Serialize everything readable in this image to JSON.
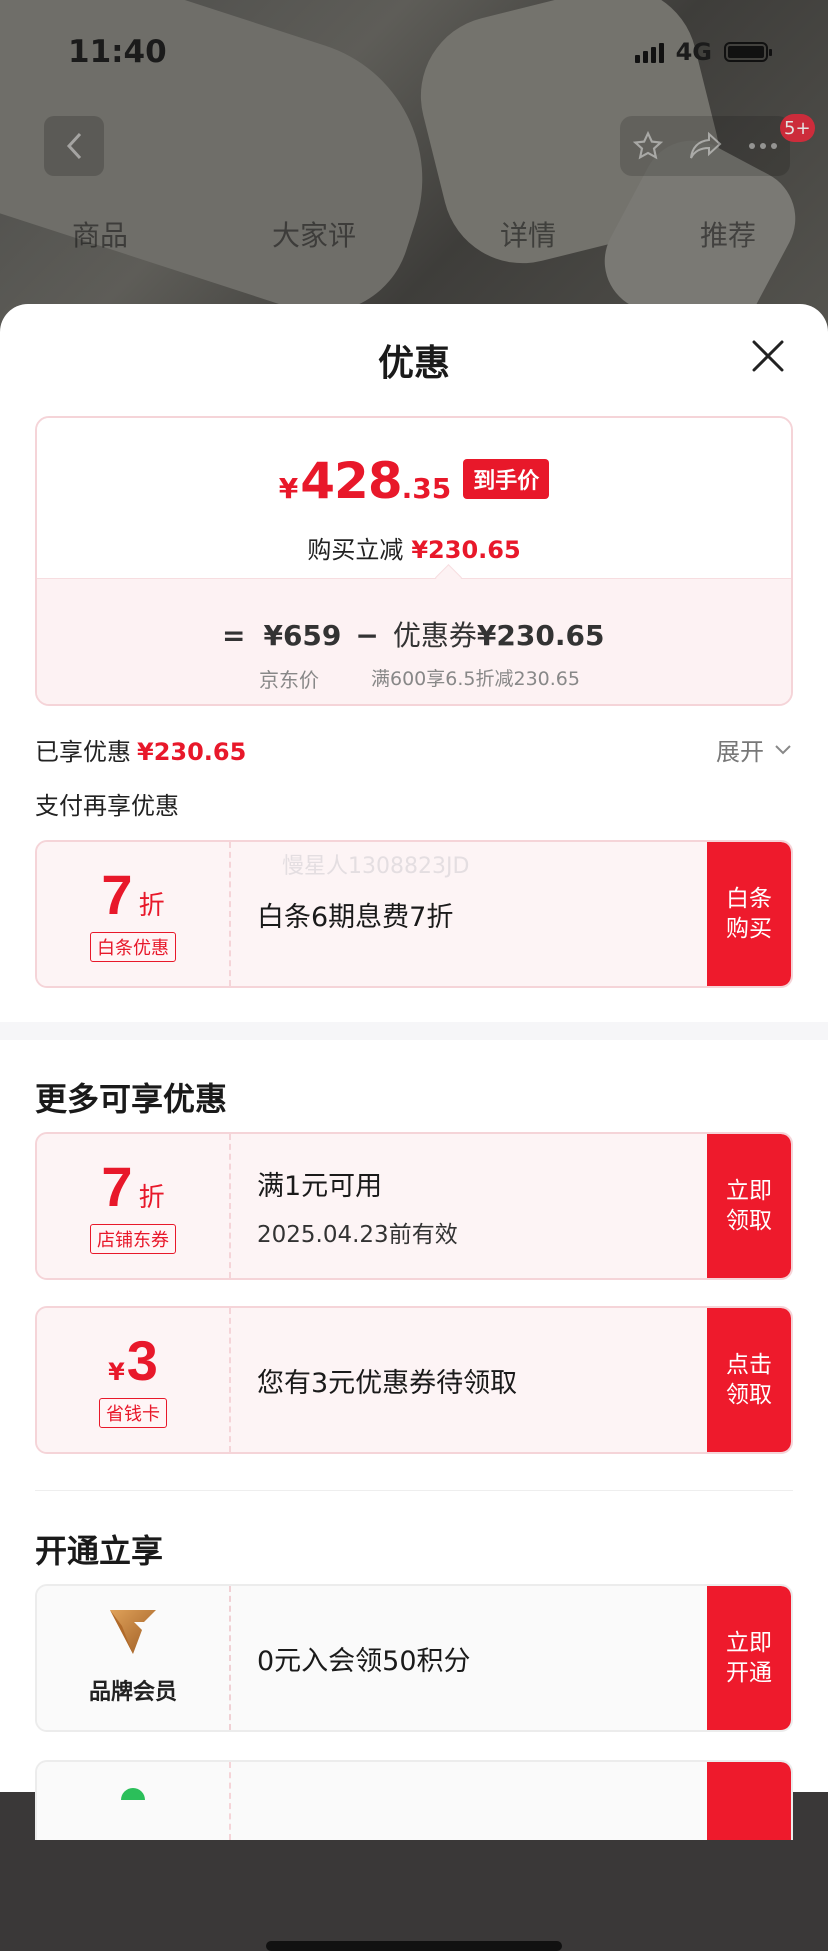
{
  "status": {
    "time": "11:40",
    "network": "4G"
  },
  "bg_page": {
    "badge": "5+",
    "tabs": [
      "商品",
      "大家评",
      "详情",
      "推荐"
    ]
  },
  "sheet": {
    "title": "优惠",
    "price_card": {
      "currency": "¥",
      "price_int": "428",
      "price_dec": ".35",
      "price_tag": "到手价",
      "reduce_label": "购买立减",
      "reduce_amount": "¥230.65",
      "eq": "=",
      "jd_price": "¥659",
      "minus": "−",
      "coupon_label": "优惠券",
      "coupon_amount": "¥230.65",
      "jd_price_label": "京东价",
      "coupon_rule": "满600享6.5折减230.65"
    },
    "enjoyed_label": "已享优惠",
    "enjoyed_amount": "¥230.65",
    "expand_label": "展开",
    "pay_more_label": "支付再享优惠",
    "watermark": "慢星人1308823JD",
    "pay_coupons": [
      {
        "value": "7",
        "unit": "折",
        "tag": "白条优惠",
        "title": "白条6期息费7折",
        "cta": "白条购买"
      }
    ],
    "more_title": "更多可享优惠",
    "more_coupons": [
      {
        "value": "7",
        "unit": "折",
        "tag": "店铺东券",
        "title": "满1元可用",
        "subtitle": "2025.04.23前有效",
        "cta": "立即领取"
      },
      {
        "currency": "¥",
        "value": "3",
        "tag": "省钱卡",
        "title": "您有3元优惠券待领取",
        "cta": "点击领取"
      }
    ],
    "open_title": "开通立享",
    "open_items": [
      {
        "label": "品牌会员",
        "title": "0元入会领50积分",
        "cta": "立即开通"
      }
    ]
  },
  "colors": {
    "accent": "#e8182a",
    "cta": "#ee1a2c",
    "card_border": "#f5d4d8"
  },
  "icons": [
    "back-icon",
    "star-icon",
    "share-icon",
    "more-icon",
    "close-icon",
    "chevron-down-icon",
    "brand-v-logo-icon"
  ]
}
